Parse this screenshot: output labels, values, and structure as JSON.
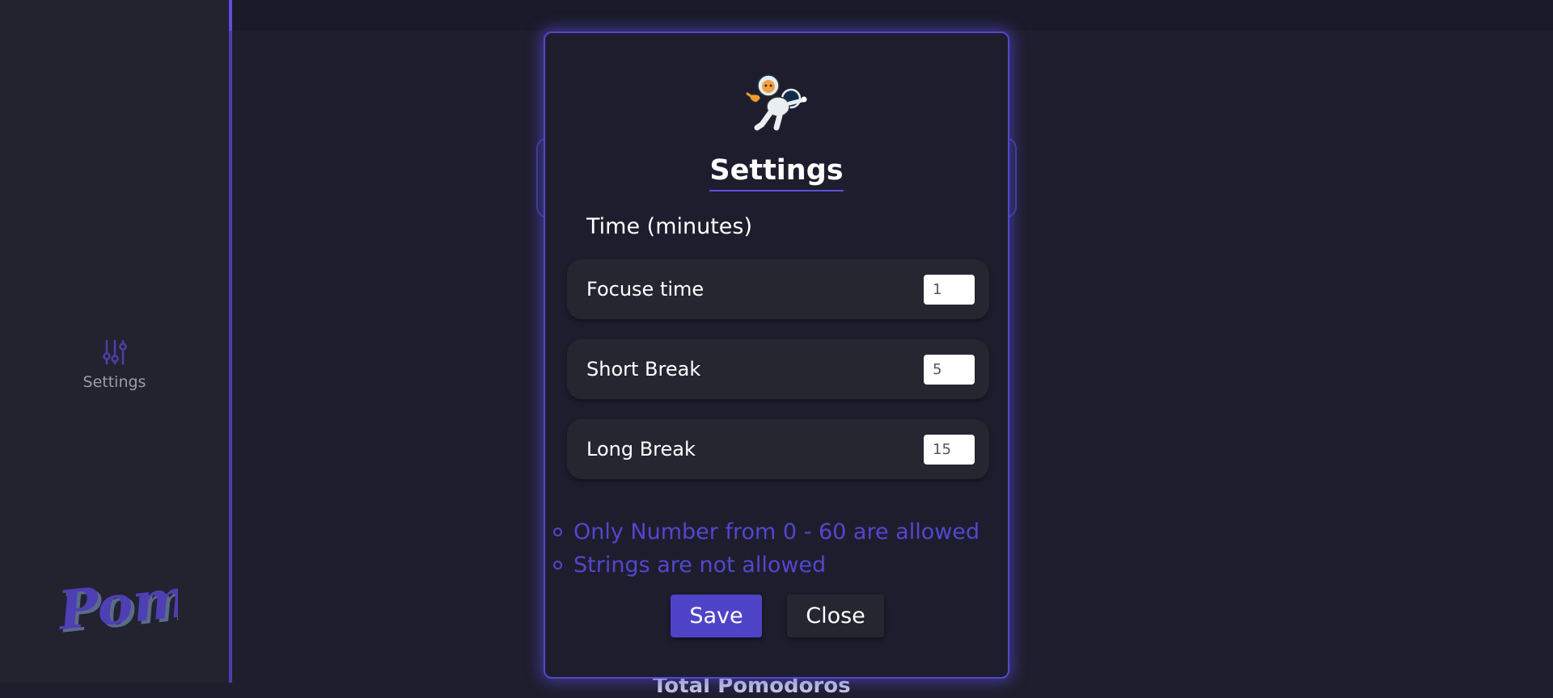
{
  "sidebar": {
    "settings_label": "Settings",
    "settings_icon": "sliders-icon",
    "logo_text": "Pomy"
  },
  "background": {
    "partial_text": "Total Pomodoros"
  },
  "modal": {
    "title": "Settings",
    "section_label": "Time (minutes)",
    "fields": [
      {
        "label": "Focuse time",
        "value": "1"
      },
      {
        "label": "Short Break",
        "value": "5"
      },
      {
        "label": "Long Break",
        "value": "15"
      }
    ],
    "rules": [
      "Only Number from 0 - 60 are allowed",
      "Strings are not allowed"
    ],
    "save_label": "Save",
    "close_label": "Close"
  },
  "colors": {
    "accent": "#5247cf",
    "background": "#1f1e2e",
    "sidebar": "#23222f",
    "row": "#262631"
  }
}
